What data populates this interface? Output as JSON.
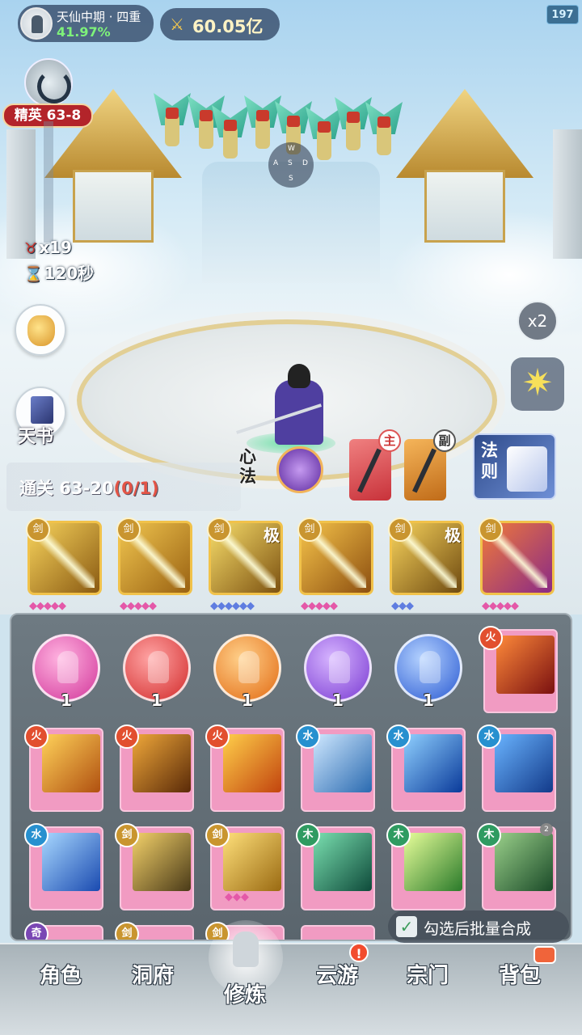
{
  "hud": {
    "realm": "天仙中期 · 四重",
    "realm_progress": "41.97%",
    "power": "60.05亿",
    "fps": "197"
  },
  "stage": {
    "badge": "精英 63-8",
    "enemy_count": "x19",
    "timer": "120秒",
    "clear_label": "通关 63-20",
    "clear_progress": "(0/1)"
  },
  "side": {
    "book_label": "天书",
    "speed_label": "x2"
  },
  "loadout": {
    "xinfa_label": "心法",
    "weapon_main_tag": "主",
    "weapon_sub_tag": "副",
    "fa_label": "法则"
  },
  "equipped_skills": [
    {
      "icon": "sword-slash-gold",
      "tag": "",
      "gems": "◆◆◆◆◆"
    },
    {
      "icon": "sword-rain-gold",
      "tag": "",
      "gems": "◆◆◆◆◆"
    },
    {
      "icon": "sword-burst-gold",
      "tag": "极",
      "gems": "◆◆◆◆◆◆"
    },
    {
      "icon": "sword-storm-gold",
      "tag": "",
      "gems": "◆◆◆◆◆"
    },
    {
      "icon": "sword-fan-gold",
      "tag": "极",
      "gems": "◆◆◆"
    },
    {
      "icon": "comet-gold",
      "tag": "",
      "gems": "◆◆◆◆◆"
    }
  ],
  "inventory": {
    "orbs": [
      {
        "color": "pink",
        "count": "1"
      },
      {
        "color": "red",
        "count": "1"
      },
      {
        "color": "orange",
        "count": "1"
      },
      {
        "color": "purple",
        "count": "1"
      },
      {
        "color": "blue",
        "count": "1"
      }
    ],
    "batch_label": "勾选后批量合成"
  },
  "nav": {
    "items": [
      "角色",
      "洞府",
      "修炼",
      "云游",
      "宗门",
      "背包"
    ],
    "active": "修炼",
    "alert": "!"
  }
}
